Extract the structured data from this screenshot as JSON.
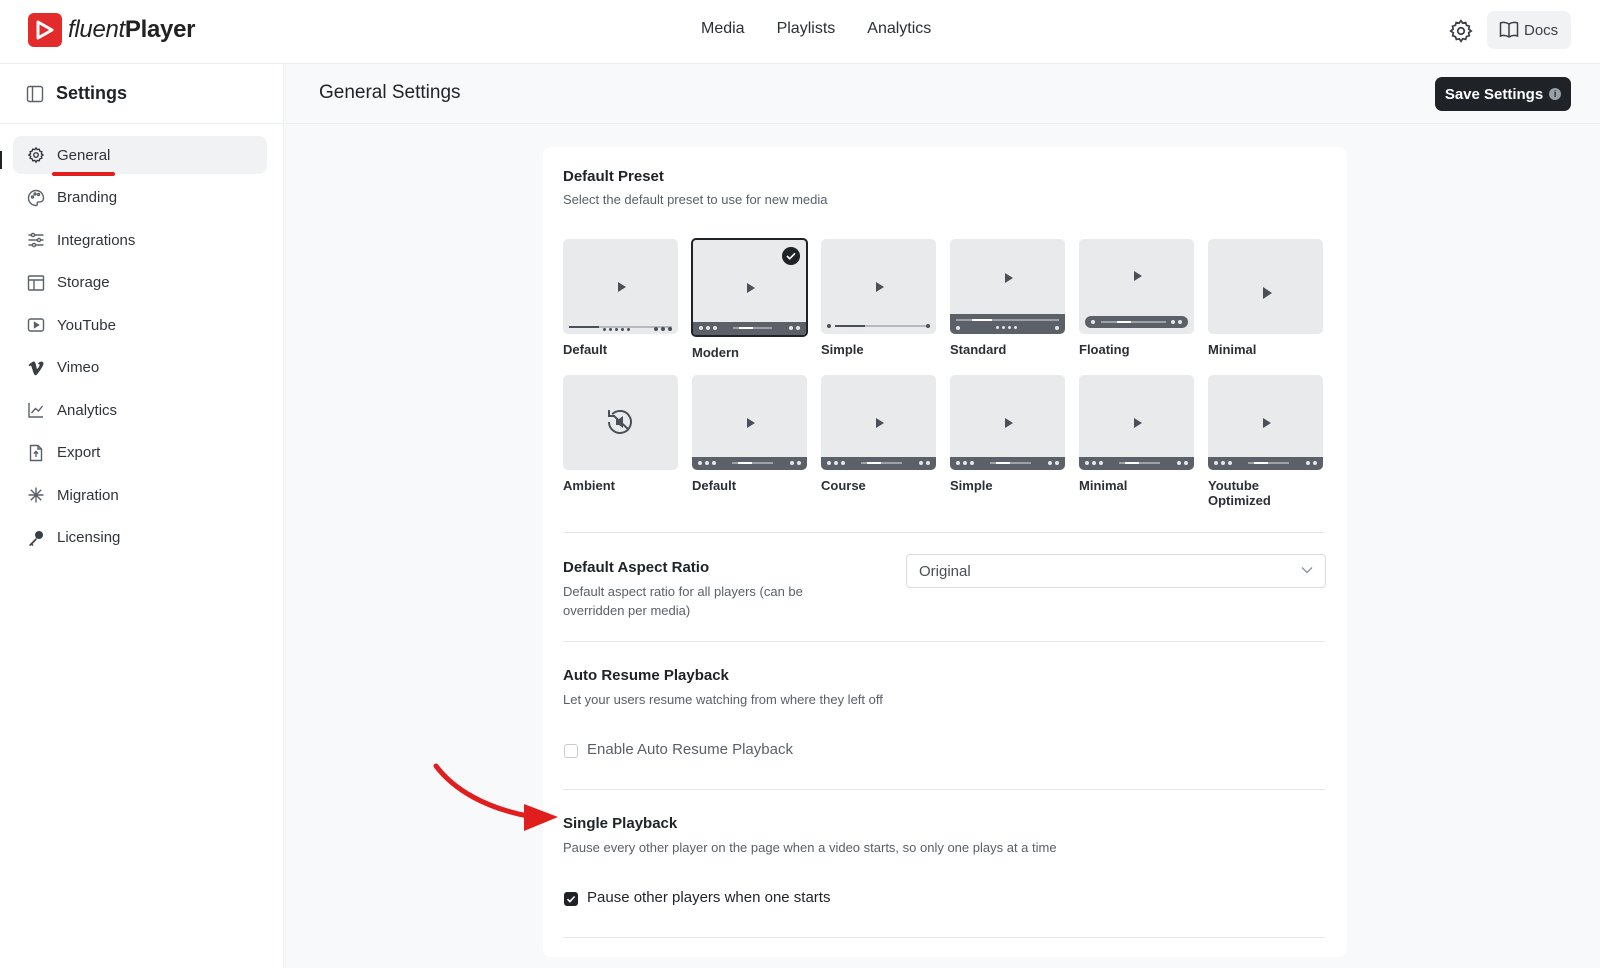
{
  "app": {
    "brand_a": "fluent",
    "brand_b": "Player",
    "nav": [
      "Media",
      "Playlists",
      "Analytics"
    ],
    "docs_label": "Docs"
  },
  "sidebar": {
    "title": "Settings",
    "items": [
      {
        "label": "General",
        "icon": "gear-icon",
        "active": true
      },
      {
        "label": "Branding",
        "icon": "palette-icon"
      },
      {
        "label": "Integrations",
        "icon": "sliders-icon"
      },
      {
        "label": "Storage",
        "icon": "storage-icon"
      },
      {
        "label": "YouTube",
        "icon": "youtube-icon"
      },
      {
        "label": "Vimeo",
        "icon": "vimeo-icon"
      },
      {
        "label": "Analytics",
        "icon": "chart-icon"
      },
      {
        "label": "Export",
        "icon": "export-icon"
      },
      {
        "label": "Migration",
        "icon": "migration-icon"
      },
      {
        "label": "Licensing",
        "icon": "key-icon"
      }
    ]
  },
  "header": {
    "title": "General Settings",
    "save_label": "Save Settings"
  },
  "default_preset": {
    "title": "Default Preset",
    "desc": "Select the default preset to use for new media",
    "row1": [
      "Default",
      "Modern",
      "Simple",
      "Standard",
      "Floating",
      "Minimal"
    ],
    "row2": [
      "Ambient",
      "Default",
      "Course",
      "Simple",
      "Minimal",
      "Youtube Optimized"
    ],
    "selected": "Modern"
  },
  "aspect_ratio": {
    "title": "Default Aspect Ratio",
    "desc": "Default aspect ratio for all players (can be overridden per media)",
    "value": "Original"
  },
  "auto_resume": {
    "title": "Auto Resume Playback",
    "desc": "Let your users resume watching from where they left off",
    "checkbox_label": "Enable Auto Resume Playback",
    "checked": false
  },
  "single_playback": {
    "title": "Single Playback",
    "desc": "Pause every other player on the page when a video starts, so only one plays at a time",
    "checkbox_label": "Pause other players when one starts",
    "checked": true
  },
  "colors": {
    "brand": "#e32b2b",
    "primary": "#1f2328",
    "annotation": "#e01e1e"
  }
}
